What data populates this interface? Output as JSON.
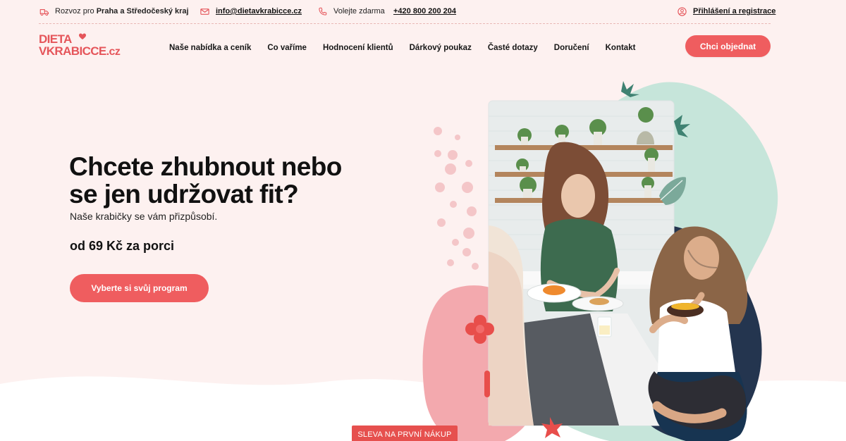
{
  "topbar": {
    "delivery_prefix": "Rozvoz pro",
    "delivery_region": "Praha a Středočeský kraj",
    "email": "info@dietavkrabicce.cz",
    "call_prefix": "Volejte zdarma",
    "phone": "+420 800 200 204",
    "login": "Přihlášení a registrace"
  },
  "brand": {
    "line1": "DIETA",
    "line2": "VKRABICCE",
    "suffix": ".cz"
  },
  "nav": {
    "items": [
      "Naše nabídka a ceník",
      "Co vaříme",
      "Hodnocení klientů",
      "Dárkový poukaz",
      "Časté dotazy",
      "Doručení",
      "Kontakt"
    ],
    "cta": "Chci objednat"
  },
  "hero": {
    "title_line1": "Chcete zhubnout nebo",
    "title_line2": "se jen udržovat fit?",
    "subtitle": "Naše krabičky se vám přizpůsobí.",
    "price": "od 69 Kč za porci",
    "button": "Vyberte si svůj program"
  },
  "promo": {
    "label": "SLEVA NA PRVNÍ NÁKUP"
  },
  "colors": {
    "accent": "#ef5d5f",
    "background": "#fdf1f0",
    "mint": "#c6e5da",
    "pink_blob": "#f2a7ad"
  },
  "icons": {
    "delivery": "delivery-truck-icon",
    "email": "email-icon",
    "phone": "phone-icon",
    "account": "user-icon"
  }
}
